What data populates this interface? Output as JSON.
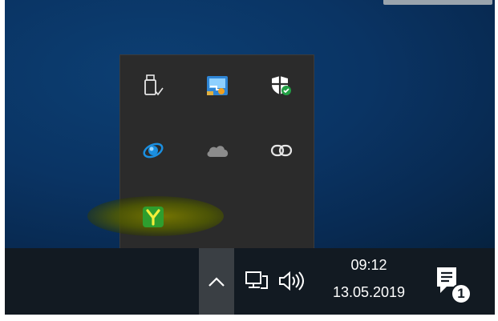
{
  "tray": {
    "clock_time": "09:12",
    "clock_date": "13.05.2019",
    "notification_count": "1"
  },
  "overflow_icons": [
    {
      "name": "usb-safely-remove-icon"
    },
    {
      "name": "network-share-tool-icon"
    },
    {
      "name": "windows-security-icon"
    },
    {
      "name": "sync-app-icon"
    },
    {
      "name": "onedrive-cloud-icon"
    },
    {
      "name": "link-app-icon"
    },
    {
      "name": "yandex-app-icon"
    }
  ],
  "colors": {
    "flyout_bg": "#2b2b2b",
    "taskbar_bg": "#121a22",
    "highlight": "#7a7a00",
    "security_green": "#22a045",
    "yandex_green": "#2e9e2e"
  }
}
